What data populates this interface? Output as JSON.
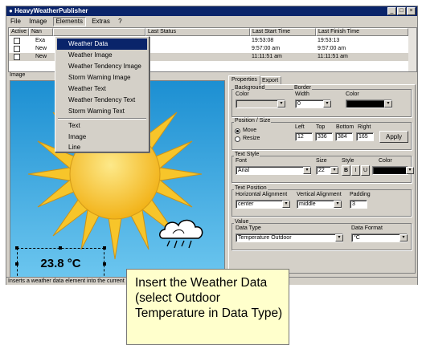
{
  "window": {
    "title": "HeavyWeatherPublisher"
  },
  "title_buttons": {
    "minimize": "_",
    "maximize": "□",
    "close": "×"
  },
  "menu": [
    "File",
    "Image",
    "Elements",
    "Extras",
    "?"
  ],
  "list": {
    "headers": {
      "active": "Active",
      "name": "Nan",
      "last_status": "Last Status",
      "last_start": "Last Start Time",
      "last_finish": "Last Finish Time"
    },
    "rows": [
      {
        "name": "Exa",
        "start": "19:53:08",
        "finish": "19:53:13",
        "selected": false
      },
      {
        "name": "New",
        "start": "9:57:00 am",
        "finish": "9:57:00 am",
        "selected": false
      },
      {
        "name": "New",
        "start": "11:11:51 am",
        "finish": "11:11:51 am",
        "selected": true
      }
    ]
  },
  "image_label": "Image",
  "elements_menu": {
    "items": [
      "Weather Data",
      "Weather Image",
      "Weather Tendency Image",
      "Storm Warning Image",
      "Weather Text",
      "Weather Tendency Text",
      "Storm Warning Text"
    ],
    "items2": [
      "Text",
      "Image",
      "Line"
    ],
    "highlighted": "Weather Data"
  },
  "canvas": {
    "temperature": "23.8 °C"
  },
  "status_text": "Inserts a weather data element into the current i",
  "tabs": [
    "Properties",
    "Export"
  ],
  "properties": {
    "background": {
      "group": "Background",
      "color_label": "Color"
    },
    "border": {
      "group": "Border",
      "width_label": "Width",
      "width_value": "0",
      "color_label": "Color"
    },
    "position": {
      "group": "Position / Size",
      "move": "Move",
      "resize": "Resize",
      "selected": "Move",
      "left_label": "Left",
      "top_label": "Top",
      "bottom_label": "Bottom",
      "right_label": "Right",
      "left": "12",
      "top": "336",
      "bottom": "384",
      "right": "165",
      "apply": "Apply"
    },
    "text_style": {
      "group": "Text Style",
      "font_label": "Font",
      "font": "Arial",
      "size_label": "Size",
      "size": "22",
      "style_label": "Style",
      "bold": "B",
      "italic": "I",
      "underline": "U",
      "color_label": "Color"
    },
    "text_position": {
      "group": "Text Position",
      "h_label": "Horizontal Alignment",
      "h_value": "center",
      "v_label": "Vertical Alignment",
      "v_value": "middle",
      "padding_label": "Padding",
      "padding_value": "3"
    },
    "value": {
      "group": "Value",
      "type_label": "Data Type",
      "type_value": "Temperature Outdoor",
      "format_label": "Data Format",
      "format_value": "°C"
    }
  },
  "callout": {
    "line1": "Insert the Weather Data",
    "line2": "(select Outdoor",
    "line3": "Temperature in Data Type)"
  },
  "colors": {
    "titlebar": "#0a246a",
    "sky": "#24a8e0",
    "sun": "#f6cd34",
    "callout": "#ffffcc"
  }
}
